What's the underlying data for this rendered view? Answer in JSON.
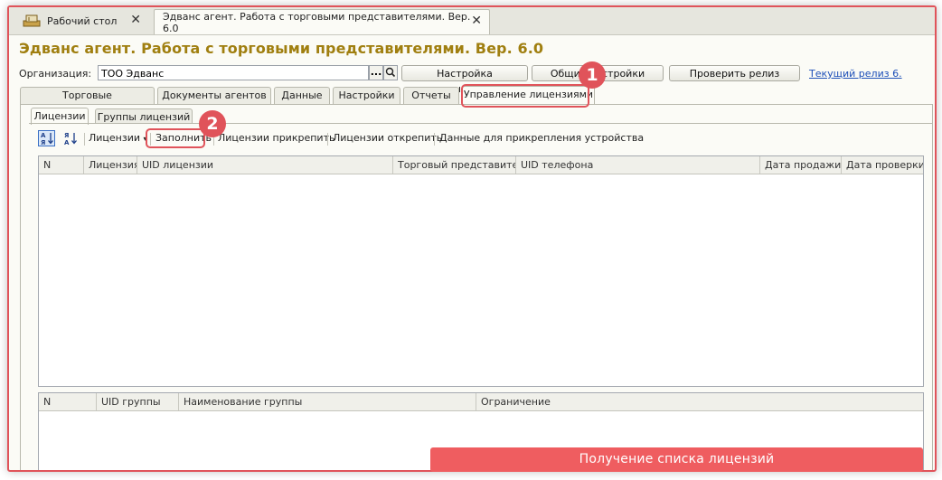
{
  "window_tabs": [
    {
      "label": "Рабочий стол"
    },
    {
      "label": "Эдванс агент. Работа с торговыми представителями. Вер. 6.0"
    }
  ],
  "title": "Эдванс агент. Работа с торговыми представителями. Вер. 6.0",
  "org": {
    "label": "Организация:",
    "value": "ТОО Эдванс",
    "dots": "...",
    "buttons": {
      "settings": "Настройка организации",
      "common": "Общие настройки",
      "check": "Проверить релиз"
    },
    "release_link": "Текущий релиз 6."
  },
  "main_tabs": [
    "Торговые представители",
    "Документы агентов",
    "Данные",
    "Настройки",
    "Отчеты",
    "Управление лицензиями"
  ],
  "sub_tabs": [
    "Лицензии",
    "Группы лицензий"
  ],
  "toolbar": {
    "licenses": "Лицензии",
    "fill": "Заполнить",
    "attach": "Лицензии прикрепить",
    "detach": "Лицензии открепить",
    "device": "Данные для прикрепления устройства"
  },
  "licenses_table": {
    "columns": [
      "N",
      "Лицензия",
      "UID лицензии",
      "Торговый представитель",
      "UID телефона",
      "Дата продажи",
      "Дата проверки"
    ]
  },
  "groups_table": {
    "columns": [
      "N",
      "UID группы",
      "Наименование группы",
      "Ограничение"
    ]
  },
  "markers": [
    "1",
    "2"
  ],
  "banner": "Получение списка лицензий",
  "colors": {
    "accent": "#e0535a",
    "title": "#a07f10",
    "link": "#1d4fb8"
  }
}
